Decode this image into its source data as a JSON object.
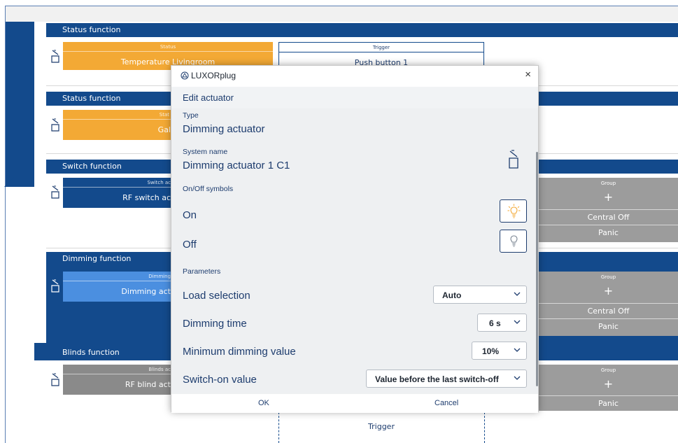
{
  "app": {
    "title": "LUXORplug"
  },
  "sections": {
    "status1": {
      "label": "Status function",
      "card_cat": "Status",
      "card_name": "Temperature Livingroom",
      "trigger_cat": "Trigger",
      "trigger_name": "Push button 1"
    },
    "status2": {
      "label": "Status function",
      "card_cat": "Stat",
      "card_name": "Gal"
    },
    "switch": {
      "label": "Switch function",
      "card_cat": "Switch ac",
      "card_name": "RF switch ac",
      "group": {
        "head": "Group",
        "plus": "+",
        "items": [
          "Central Off",
          "Panic"
        ]
      }
    },
    "dimming": {
      "label": "Dimming function",
      "card_cat": "Dimming",
      "card_name": "Dimming act",
      "group": {
        "head": "Group",
        "plus": "+",
        "items": [
          "Central Off",
          "Panic"
        ]
      }
    },
    "blinds": {
      "label": "Blinds function",
      "card_cat": "Blinds ac",
      "card_name": "RF blind act",
      "group": {
        "head": "Group",
        "plus": "+",
        "items": [
          "Panic"
        ]
      }
    },
    "bottom_trigger": "Trigger"
  },
  "dialog": {
    "header": "Edit actuator",
    "type_label": "Type",
    "type_value": "Dimming actuator",
    "system_name_label": "System name",
    "system_name_value": "Dimming actuator 1 C1",
    "symbols_label": "On/Off symbols",
    "on_label": "On",
    "off_label": "Off",
    "parameters_label": "Parameters",
    "params": {
      "load_selection": {
        "label": "Load selection",
        "value": "Auto"
      },
      "dimming_time": {
        "label": "Dimming time",
        "value": "6 s"
      },
      "minimum_dimming": {
        "label": "Minimum dimming value",
        "value": "10%"
      },
      "switch_on": {
        "label": "Switch-on value",
        "value": "Value before the last switch-off"
      }
    },
    "ok_label": "OK",
    "cancel_label": "Cancel",
    "close_glyph": "×"
  },
  "colors": {
    "navy": "#134a8c",
    "orange": "#f3a935",
    "dim_blue": "#4b8fe0",
    "grey": "#8a8a8a",
    "group_grey": "#9c9c9c"
  }
}
